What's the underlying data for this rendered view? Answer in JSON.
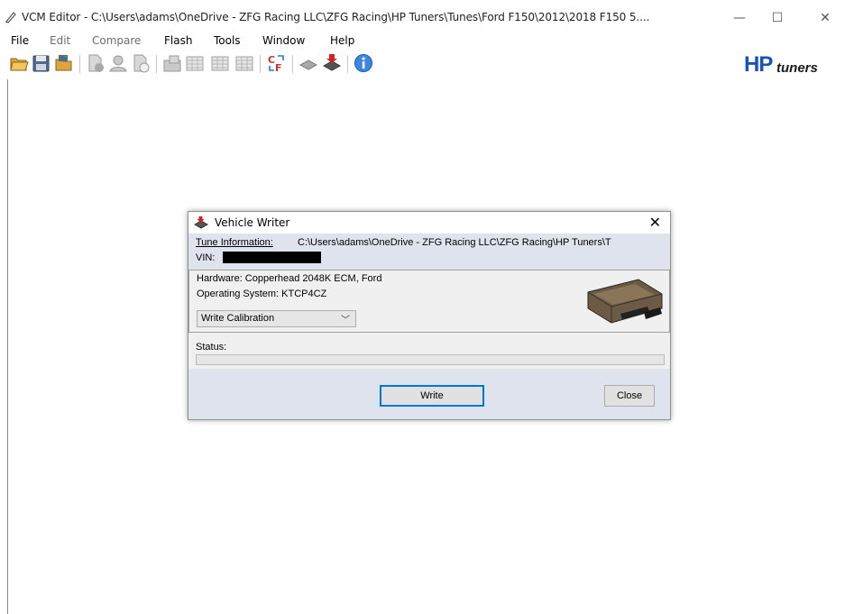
{
  "window": {
    "title": "VCM Editor - C:\\Users\\adams\\OneDrive - ZFG Racing LLC\\ZFG Racing\\HP Tuners\\Tunes\\Ford F150\\2012\\2018 F150 5....",
    "minimize": "—",
    "maximize": "☐",
    "close": "✕"
  },
  "menu": [
    {
      "label": "File",
      "enabled": true
    },
    {
      "label": "Edit",
      "enabled": false
    },
    {
      "label": "Compare",
      "enabled": false
    },
    {
      "label": "Flash",
      "enabled": true
    },
    {
      "label": "Tools",
      "enabled": true
    },
    {
      "label": "Window",
      "enabled": true
    },
    {
      "label": "Help",
      "enabled": true
    }
  ],
  "toolbar": {
    "icons": [
      "open-folder-icon",
      "save-icon",
      "save-as-icon",
      "file-info-icon",
      "user-icon",
      "file-compare-icon",
      "import-icon",
      "table-icon",
      "table-2-icon",
      "table-3-icon",
      "swap-icon",
      "read-vehicle-icon",
      "write-vehicle-icon",
      "info-icon"
    ],
    "logo_hp": "HP",
    "logo_tuners": "tuners"
  },
  "dialog": {
    "title": "Vehicle Writer",
    "close": "✕",
    "tune_info_label": "Tune Information:",
    "tune_info_value": "C:\\Users\\adams\\OneDrive - ZFG Racing LLC\\ZFG Racing\\HP Tuners\\T",
    "vin_label": "VIN:",
    "hardware": "Hardware: Copperhead 2048K ECM, Ford",
    "operating_system": "Operating System: KTCP4CZ",
    "write_mode": "Write Calibration",
    "status_label": "Status:",
    "progress": 0,
    "write_button": "Write",
    "close_button": "Close"
  },
  "colors": {
    "accent": "#0078d7",
    "info_band": "#dfe3ee",
    "logo_blue": "#1554c0"
  }
}
